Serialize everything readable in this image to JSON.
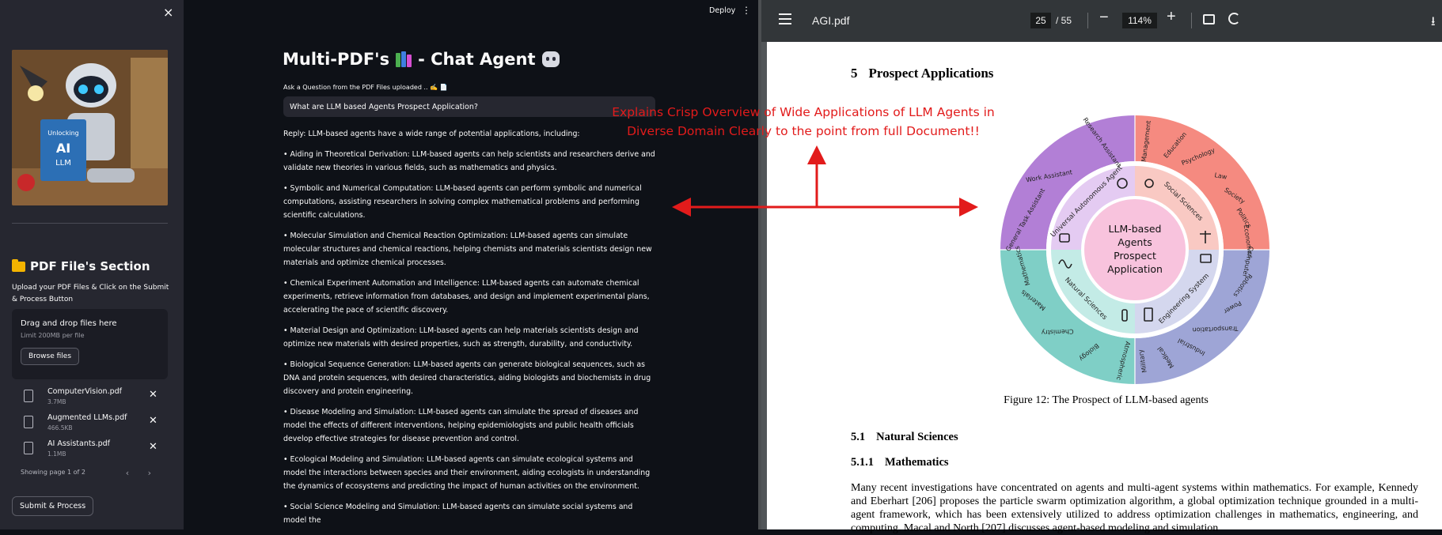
{
  "sidebar": {
    "close_label": "×",
    "section_title": "PDF File's Section",
    "upload_hint": "Upload your PDF Files & Click on the Submit & Process Button",
    "dropzone": {
      "title": "Drag and drop files here",
      "limit": "Limit 200MB per file",
      "browse_label": "Browse files"
    },
    "files": [
      {
        "name": "ComputerVision.pdf",
        "size": "3.7MB"
      },
      {
        "name": "Augmented LLMs.pdf",
        "size": "466.5KB"
      },
      {
        "name": "AI Assistants.pdf",
        "size": "1.1MB"
      }
    ],
    "remove_label": "✕",
    "pager": "Showing page 1 of 2",
    "pager_arrows": "‹ ›",
    "submit_label": "Submit & Process",
    "robot_image_text": {
      "book_line1": "Unlocking",
      "book_line2": "AI",
      "book_line3": "LLM"
    }
  },
  "header": {
    "deploy_label": "Deploy",
    "menu_label": "⋮"
  },
  "chat": {
    "title_prefix": "Multi-PDF's",
    "title_suffix": "- Chat Agent",
    "ask_label": "Ask a Question from the PDF Files uploaded .. ✍️ 📄",
    "question_value": "What are LLM based Agents Prospect Application?",
    "reply_paragraphs": [
      "Reply: LLM-based agents have a wide range of potential applications, including:",
      "• Aiding in Theoretical Derivation: LLM-based agents can help scientists and researchers derive and validate new theories in various fields, such as mathematics and physics.",
      "• Symbolic and Numerical Computation: LLM-based agents can perform symbolic and numerical computations, assisting researchers in solving complex mathematical problems and performing scientific calculations.",
      "• Molecular Simulation and Chemical Reaction Optimization: LLM-based agents can simulate molecular structures and chemical reactions, helping chemists and materials scientists design new materials and optimize chemical processes.",
      "• Chemical Experiment Automation and Intelligence: LLM-based agents can automate chemical experiments, retrieve information from databases, and design and implement experimental plans, accelerating the pace of scientific discovery.",
      "• Material Design and Optimization: LLM-based agents can help materials scientists design and optimize new materials with desired properties, such as strength, durability, and conductivity.",
      "• Biological Sequence Generation: LLM-based agents can generate biological sequences, such as DNA and protein sequences, with desired characteristics, aiding biologists and biochemists in drug discovery and protein engineering.",
      "• Disease Modeling and Simulation: LLM-based agents can simulate the spread of diseases and model the effects of different interventions, helping epidemiologists and public health officials develop effective strategies for disease prevention and control.",
      "• Ecological Modeling and Simulation: LLM-based agents can simulate ecological systems and model the interactions between species and their environment, aiding ecologists in understanding the dynamics of ecosystems and predicting the impact of human activities on the environment.",
      "• Social Science Modeling and Simulation: LLM-based agents can simulate social systems and model the"
    ]
  },
  "annotation": {
    "line1": "Explains Crisp Overview of Wide Applications of LLM Agents in",
    "line2": "Diverse Domain Clearly to the point from full Document!!",
    "color": "#e21b1b"
  },
  "pdf_viewer": {
    "file_name": "AGI.pdf",
    "current_page": "25",
    "total_pages": "/ 55",
    "zoom": "114%",
    "zoom_out": "−",
    "zoom_in": "+",
    "download": "⭳",
    "section_number": "5",
    "section_title": "Prospect Applications",
    "figure": {
      "center_lines": [
        "LLM-based",
        "Agents",
        "Prospect",
        "Application"
      ],
      "middle_ring": [
        "Universal Autonomous Agent",
        "Social Sciences",
        "Engineering System",
        "Natural Sciences"
      ],
      "outer_labels": {
        "agent": [
          "Research Assistant",
          "Work Assistant",
          "General Task Assistant"
        ],
        "social": [
          "Management",
          "Education",
          "Psychology",
          "Law",
          "Society",
          "Politics",
          "Economics"
        ],
        "engineering": [
          "Computer",
          "Robotics",
          "Power",
          "Transportation",
          "Industrial",
          "Medical",
          "Military"
        ],
        "natural": [
          "Atmospheric",
          "Biology",
          "Chemistry",
          "Materials",
          "Mathematics"
        ]
      },
      "colors": {
        "agent": "#b27fd6",
        "social": "#f58a80",
        "engineering": "#9ea5d6",
        "natural": "#7fcfc6"
      },
      "caption": "Figure 12: The Prospect of LLM-based agents"
    },
    "sub1_number": "5.1",
    "sub1_title": "Natural Sciences",
    "sub2_number": "5.1.1",
    "sub2_title": "Mathematics",
    "body": "Many recent investigations have concentrated on agents and multi-agent systems within mathematics. For example, Kennedy and Eberhart [206] proposes the particle swarm optimization algorithm, a global optimization technique grounded in a multi-agent framework, which has been extensively utilized to address optimization challenges in mathematics, engineering, and computing. Macal and North [207] discusses agent-based modeling and simulation"
  }
}
